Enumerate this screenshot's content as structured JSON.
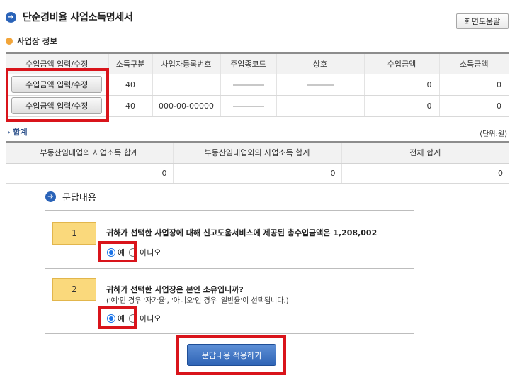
{
  "header": {
    "title": "단순경비율 사업소득명세서",
    "help_button": "화면도움말"
  },
  "business_section": {
    "label": "사업장 정보",
    "columns": [
      "수입금액 입력/수정",
      "소득구분",
      "사업자등록번호",
      "주업종코드",
      "상호",
      "수입금액",
      "소득금액"
    ],
    "rows": [
      {
        "button": "수입금액 입력/수정",
        "income_type": "40",
        "reg_no": "",
        "revenue": "0",
        "income": "0"
      },
      {
        "button": "수입금액 입력/수정",
        "income_type": "40",
        "reg_no": "000-00-00000",
        "revenue": "0",
        "income": "0"
      }
    ]
  },
  "summary": {
    "label": "합계",
    "unit": "(단위:원)",
    "columns": [
      "부동산임대업의 사업소득 합계",
      "부동산임대업외의 사업소득 합계",
      "전체 합계"
    ],
    "values": [
      "0",
      "0",
      "0"
    ]
  },
  "qa": {
    "title": "문답내용",
    "questions": [
      {
        "number": "1",
        "text": "귀하가 선택한 사업장에 대해 신고도움서비스에 제공된 총수입금액은 1,208,002",
        "sub": "",
        "options": [
          "예",
          "아니오"
        ],
        "selected": "예"
      },
      {
        "number": "2",
        "text": "귀하가 선택한 사업장은 본인 소유입니까?",
        "sub": "('예'인 경우 '자가율', '아니오'인 경우 '일반율'이 선택됩니다.)",
        "options": [
          "예",
          "아니오"
        ],
        "selected": "예"
      }
    ],
    "apply_button": "문답내용 적용하기"
  },
  "colors": {
    "accent_blue": "#2a63b8",
    "highlight_red": "#d9141b",
    "question_badge": "#fad97c",
    "section_dot": "#f2a53a"
  }
}
